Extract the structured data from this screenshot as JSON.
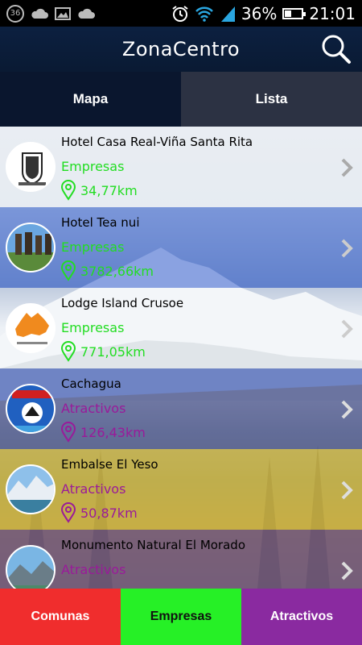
{
  "status_bar": {
    "notification_badge": "36",
    "battery_percent": "36%",
    "battery_level": 0.36,
    "time": "21:01",
    "icons": [
      "cloud-icon",
      "image-icon",
      "cloud-icon",
      "alarm-icon",
      "wifi-icon",
      "signal-icon",
      "battery-icon"
    ]
  },
  "app_bar": {
    "title": "ZonaCentro",
    "search_icon": "search-icon"
  },
  "tabs": [
    {
      "label": "Mapa",
      "selected": false
    },
    {
      "label": "Lista",
      "selected": true
    }
  ],
  "list": {
    "items": [
      {
        "name": "Hotel Casa Real-Viña Santa Rita",
        "category": "Empresas",
        "distance": "34,77km",
        "category_color": "#22dd22",
        "thumbnail": "coat-of-arms"
      },
      {
        "name": "Hotel Tea nui",
        "category": "Empresas",
        "distance": "3782,66km",
        "category_color": "#22dd22",
        "thumbnail": "moai-statues"
      },
      {
        "name": "Lodge Island Crusoe",
        "category": "Empresas",
        "distance": "771,05km",
        "category_color": "#22dd22",
        "thumbnail": "orange-island-logo"
      },
      {
        "name": "Cachagua",
        "category": "Atractivos",
        "distance": "126,43km",
        "category_color": "#9a1a9a",
        "thumbnail": "municipal-shield"
      },
      {
        "name": "Embalse El Yeso",
        "category": "Atractivos",
        "distance": "50,87km",
        "category_color": "#9a1a9a",
        "thumbnail": "mountain-lake"
      },
      {
        "name": "Monumento Natural El Morado",
        "category": "Atractivos",
        "distance": "",
        "category_color": "#9a1a9a",
        "thumbnail": "mountain-valley"
      }
    ]
  },
  "bottom_nav": [
    {
      "label": "Comunas",
      "color": "#f02d2d",
      "text_color": "#ffffff"
    },
    {
      "label": "Empresas",
      "color": "#26f026",
      "text_color": "#111111"
    },
    {
      "label": "Atractivos",
      "color": "#8a2aa0",
      "text_color": "#ffffff"
    }
  ]
}
